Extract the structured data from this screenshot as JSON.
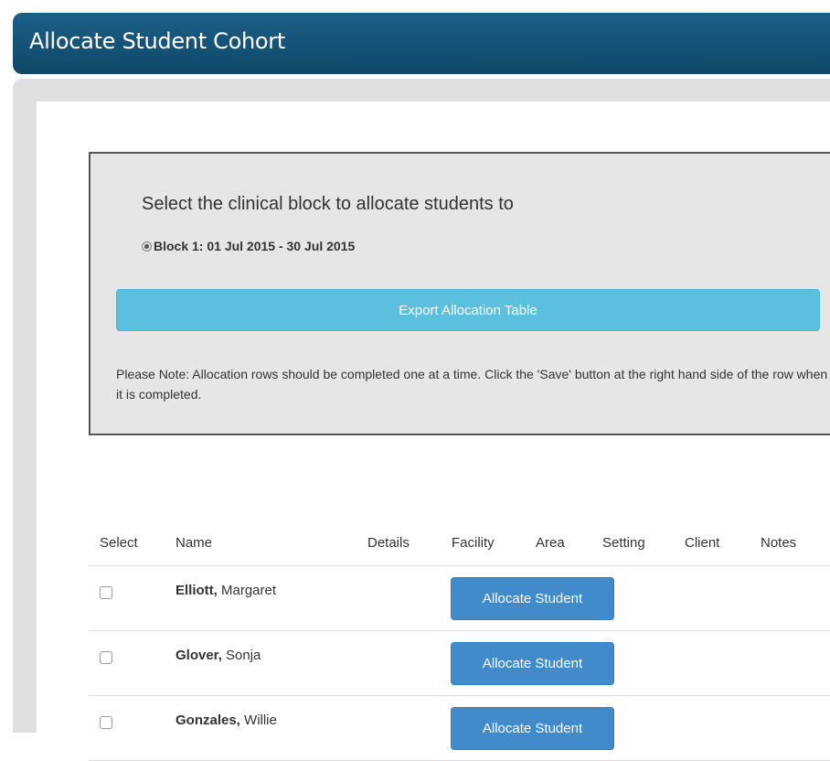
{
  "header": {
    "title": "Allocate Student Cohort"
  },
  "block_panel": {
    "heading": "Select the clinical block to allocate students to",
    "block_option": "Block 1: 01 Jul 2015 - 30 Jul 2015",
    "export_label": "Export Allocation Table",
    "note": "Please Note: Allocation rows should be completed one at a time. Click the 'Save' button at the right hand side of the row when it is completed."
  },
  "table": {
    "columns": [
      "Select",
      "Name",
      "Details",
      "Facility",
      "Area",
      "Setting",
      "Client",
      "Notes"
    ],
    "rows": [
      {
        "last": "Elliott,",
        "first": "Margaret",
        "action": "Allocate Student"
      },
      {
        "last": "Glover,",
        "first": "Sonja",
        "action": "Allocate Student"
      },
      {
        "last": "Gonzales,",
        "first": "Willie",
        "action": "Allocate Student"
      }
    ]
  }
}
